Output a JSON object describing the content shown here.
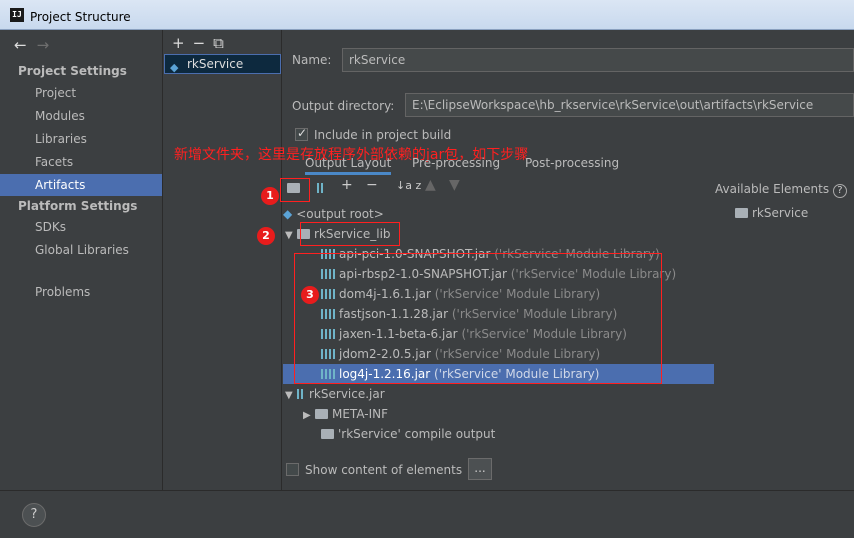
{
  "window": {
    "title": "Project Structure",
    "app_icon": "IJ"
  },
  "nav": {
    "back_icon": "←",
    "forward_icon": "→",
    "project_settings_header": "Project Settings",
    "project_settings": [
      "Project",
      "Modules",
      "Libraries",
      "Facets",
      "Artifacts"
    ],
    "platform_settings_header": "Platform Settings",
    "platform_settings": [
      "SDKs",
      "Global Libraries"
    ],
    "problems": "Problems",
    "selected": "Artifacts"
  },
  "modules_toolbar": {
    "add": "+",
    "remove": "−",
    "copy": "⧉"
  },
  "modules": [
    "rkService"
  ],
  "artifact": {
    "name_label": "Name:",
    "name_value": "rkService",
    "output_dir_label": "Output directory:",
    "output_dir_value": "E:\\EclipseWorkspace\\hb_rkservice\\rkService\\out\\artifacts\\rkService",
    "include_in_build_label": "Include in project build",
    "include_in_build_checked": true
  },
  "annotation_text": "新增文件夹，这里是存放程序外部依赖的jar包，如下步骤",
  "tabs": [
    {
      "label": "Output Layout",
      "active": true
    },
    {
      "label": "Pre-processing",
      "active": false
    },
    {
      "label": "Post-processing",
      "active": false
    }
  ],
  "layout_toolbar": {
    "add": "+",
    "remove": "−",
    "sort": "↓a z"
  },
  "tree": {
    "output_root": "<output root>",
    "lib_folder": "rkService_lib",
    "jars": [
      {
        "name": "api-pci-1.0-SNAPSHOT.jar",
        "note": "('rkService' Module Library)"
      },
      {
        "name": "api-rbsp2-1.0-SNAPSHOT.jar",
        "note": "('rkService' Module Library)"
      },
      {
        "name": "dom4j-1.6.1.jar",
        "note": "('rkService' Module Library)"
      },
      {
        "name": "fastjson-1.1.28.jar",
        "note": "('rkService' Module Library)"
      },
      {
        "name": "jaxen-1.1-beta-6.jar",
        "note": "('rkService' Module Library)"
      },
      {
        "name": "jdom2-2.0.5.jar",
        "note": "('rkService' Module Library)"
      },
      {
        "name": "log4j-1.2.16.jar",
        "note": "('rkService' Module Library)"
      }
    ],
    "selected_jar": "log4j-1.2.16.jar",
    "jar_node": "rkService.jar",
    "meta_inf": "META-INF",
    "compile_output": "'rkService' compile output"
  },
  "available": {
    "label": "Available Elements",
    "help": "?",
    "items": [
      "rkService"
    ]
  },
  "show_content_label": "Show content of elements",
  "show_content_checked": false,
  "ellipsis_button": "...",
  "help_button": "?",
  "callouts": {
    "step1": "1",
    "step2": "2",
    "step3": "3"
  },
  "colors": {
    "selection": "#4b6eaf",
    "annotation": "#ff2020",
    "background": "#3c3f41"
  }
}
